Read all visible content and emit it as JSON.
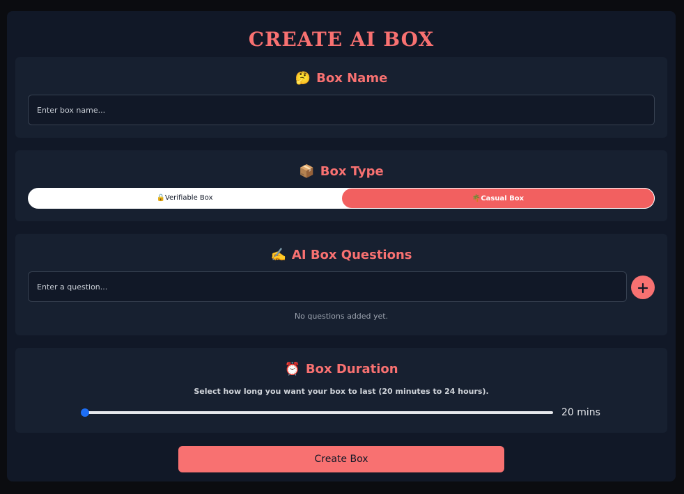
{
  "page": {
    "title": "CREATE AI BOX"
  },
  "box_name": {
    "emoji": "🤔",
    "heading": "Box Name",
    "placeholder": "Enter box name..."
  },
  "box_type": {
    "emoji": "📦",
    "heading": "Box Type",
    "options": [
      {
        "emoji": "🔒",
        "label": "Verifiable Box",
        "selected": false
      },
      {
        "emoji": "🌴",
        "label": "Casual Box",
        "selected": true
      }
    ]
  },
  "questions": {
    "emoji": "✍️",
    "heading": "AI Box Questions",
    "placeholder": "Enter a question...",
    "add_icon": "plus-icon",
    "empty_text": "No questions added yet."
  },
  "duration": {
    "emoji": "⏰",
    "heading": "Box Duration",
    "description": "Select how long you want your box to last (20 minutes to 24 hours).",
    "min_minutes": 20,
    "max_minutes": 1440,
    "value_minutes": 20,
    "value_label": "20 mins"
  },
  "actions": {
    "create_label": "Create Box"
  },
  "colors": {
    "accent": "#f87171",
    "toggle_active": "#f26060",
    "slider": "#1d6ef5",
    "background": "#111827",
    "section": "#172030"
  }
}
